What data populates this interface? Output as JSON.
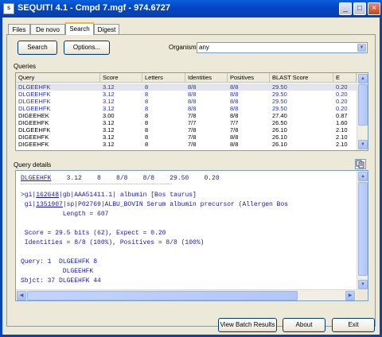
{
  "window": {
    "title": "SEQUIT! 4.1 - Cmpd 7.mgf - 974.6727",
    "app_icon": "sequit-app-icon"
  },
  "tabs": [
    {
      "label": "Files",
      "active": false
    },
    {
      "label": "De novo",
      "active": false
    },
    {
      "label": "Search",
      "active": true
    },
    {
      "label": "Digest",
      "active": false
    }
  ],
  "toolbar": {
    "search_label": "Search",
    "options_label": "Options..."
  },
  "organism": {
    "label": "Organism",
    "value": "any"
  },
  "queries": {
    "section_label": "Queries",
    "columns": [
      "Query",
      "Score",
      "Letters",
      "Identities",
      "Positives",
      "BLAST Score",
      "E"
    ],
    "rows": [
      {
        "cells": [
          "DLGEEHFK",
          "3.12",
          "8",
          "8/8",
          "8/8",
          "29.50",
          "0.20"
        ],
        "blue": true,
        "selected": true
      },
      {
        "cells": [
          "DLGEEHFK",
          "3.12",
          "8",
          "8/8",
          "8/8",
          "29.50",
          "0.20"
        ],
        "blue": true,
        "selected": false
      },
      {
        "cells": [
          "DLGEEHFK",
          "3.12",
          "8",
          "8/8",
          "8/8",
          "29.50",
          "0.20"
        ],
        "blue": true,
        "selected": false
      },
      {
        "cells": [
          "DLGEEHFK",
          "3.12",
          "8",
          "8/8",
          "8/8",
          "29.50",
          "0.20"
        ],
        "blue": true,
        "selected": false
      },
      {
        "cells": [
          "DIGEEHEK",
          "3.00",
          "8",
          "7/8",
          "8/8",
          "27.40",
          "0.87"
        ],
        "blue": false,
        "selected": false
      },
      {
        "cells": [
          "DIGEEHFK",
          "3.12",
          "8",
          "7/7",
          "7/7",
          "26.50",
          "1.60"
        ],
        "blue": false,
        "selected": false
      },
      {
        "cells": [
          "DLGEEHFK",
          "3.12",
          "8",
          "7/8",
          "7/8",
          "26.10",
          "2.10"
        ],
        "blue": false,
        "selected": false
      },
      {
        "cells": [
          "DIGEEHFK",
          "3.12",
          "8",
          "7/8",
          "8/8",
          "26.10",
          "2.10"
        ],
        "blue": false,
        "selected": false
      },
      {
        "cells": [
          "DIGEEHFK",
          "3.12",
          "8",
          "7/8",
          "8/8",
          "26.10",
          "2.10"
        ],
        "blue": false,
        "selected": false
      }
    ]
  },
  "details": {
    "section_label": "Query details",
    "copy_icon": "copy-icon",
    "summary_query": "DLGEEHFK",
    "summary_rest": "    3.12    8    8/8    8/8    29.50    0.20",
    "hit_line1_pre": ">gi|",
    "hit_line1_link": "162648",
    "hit_line1_post": "|gb|AAA51411.1| albumin [Bos taurus]",
    "hit_line2_pre": " gi|",
    "hit_line2_link": "1351907",
    "hit_line2_post": "|sp|P02769|ALBU_BOVIN Serum albumin precursor (Allergen Bos",
    "length_line": "           Length = 607",
    "score_line": " Score = 29.5 bits (62), Expect = 0.20",
    "identities_line": " Identities = 8/8 (100%), Positives = 8/8 (100%)",
    "query_line": "Query: 1  DLGEEHFK 8",
    "match_line": "           DLGEEHFK",
    "sbjct_line": "Sbjct: 37 DLGEEHFK 44"
  },
  "bottom": {
    "batch_label": "View Batch Results",
    "about_label": "About",
    "exit_label": "Exit"
  }
}
